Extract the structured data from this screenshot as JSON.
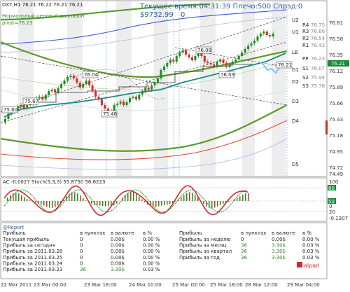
{
  "window": {
    "title_line": "DXY,H1  76.21 76.22 76.21 76.21",
    "current_price": "76.21"
  },
  "indicator_notes": {
    "range_label": "Нормальный ценовой диапазон",
    "pivot_label": "pivot=76.23"
  },
  "status": {
    "server_time": "Текущее время:04:31:39  Плечо:500  Спрэд:0",
    "balance": "$9732.99",
    "marker": "0"
  },
  "price_axis": {
    "ticks": [
      "76.81",
      "76.58",
      "76.35",
      "76.12",
      "75.89",
      "75.66",
      "75.43",
      "75.18",
      "74.95",
      "74.72",
      "74.49"
    ],
    "r_labels": [
      {
        "label": "R4",
        "value": "76.75"
      },
      {
        "label": "R3",
        "value": "76.66"
      },
      {
        "label": "R2",
        "value": "76.54"
      },
      {
        "label": "R1",
        "value": "76.43"
      },
      {
        "label": "PP",
        "value": "76.23"
      },
      {
        "label": "S1",
        "value": "76.07"
      },
      {
        "label": "S2",
        "value": "75.94"
      },
      {
        "label": "S3",
        "value": "75.78"
      }
    ]
  },
  "levels": {
    "upper": [
      "U2",
      "U1",
      "LB"
    ],
    "lower": [
      "D1",
      "D2",
      "D3",
      "D4",
      "D5"
    ]
  },
  "price_boxes": [
    "75.60",
    "75.67",
    "76.04",
    "75.46",
    "76.08",
    "76.03",
    "76.21"
  ],
  "stoch": {
    "label": "AC -0.0027  Stoch(5,3,3) 55.8750 56.6223",
    "axis": [
      "100",
      "80",
      "50",
      "20",
      "0",
      "-0.1307"
    ]
  },
  "report": {
    "title": "@Report",
    "left": {
      "headers": [
        "Прибыль",
        "в пунктах",
        "в валюте",
        "в %"
      ],
      "rows": [
        [
          "Текущая прибыль",
          "0",
          "0.00$",
          "0.00 %"
        ],
        [
          "Прибыль за сегодня",
          "0",
          "0.00$",
          "0.00 %"
        ],
        [
          "Прибыль за 2011.03.28",
          "0",
          "0.00$",
          "0.00 %"
        ],
        [
          "Прибыль за 2011.03.25",
          "0",
          "0.00$",
          "0.00 %"
        ],
        [
          "Прибыль за 2011.03.24",
          "0",
          "0.00$",
          "0.00 %"
        ],
        [
          "Прибыль за 2011.03.23",
          "36",
          "3.30$",
          "0.03 %"
        ]
      ]
    },
    "right": {
      "headers": [
        "Прибыль",
        "в пунктах",
        "в валюте",
        "в %"
      ],
      "rows": [
        [
          "Прибыль за неделю",
          "0",
          "0.00$",
          "0.00 %"
        ],
        [
          "Прибыль за месяц",
          "36",
          "3.30$",
          "0.03 %"
        ],
        [
          "Прибыль за квартал",
          "36",
          "3.30$",
          "0.03 %"
        ],
        [
          "Прибыль за год",
          "36",
          "3.30$",
          "0.03 %"
        ]
      ]
    }
  },
  "brand": "alpari",
  "time_axis": [
    "22 Mar 2011",
    "23 Mar 00:00",
    "23 Mar 18:00",
    "24 Mar 10:00",
    "25 Mar 02:00",
    "25 Mar 18:00",
    "28 Mar 12:00",
    "29 Mar 04:00"
  ],
  "colors": {
    "bull": "#1f8f1f",
    "bear": "#d42a2a",
    "ma": "#1a8a8a",
    "band_green": "#5a9a2a",
    "band_blue": "#3a5ad0",
    "report_blue": "#2d5fa8"
  }
}
